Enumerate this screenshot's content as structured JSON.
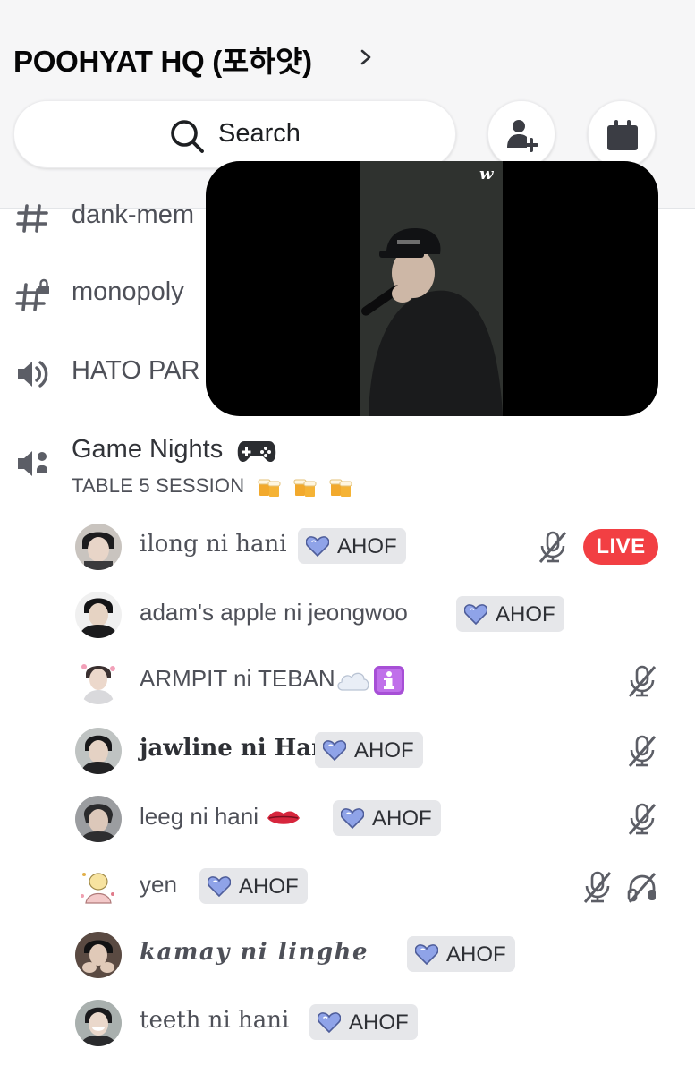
{
  "server": {
    "title": "POOHYAT HQ (포하얏)"
  },
  "search": {
    "label": "Search"
  },
  "channels": [
    {
      "name": "dank-mem"
    },
    {
      "name": "monopoly"
    },
    {
      "name": "HATO PAR"
    },
    {
      "name": "Game Nights",
      "subtitle": "TABLE 5 SESSION"
    }
  ],
  "pip": {
    "logo": "w"
  },
  "members": [
    {
      "name": "ilong ni hani",
      "tag": "AHOF",
      "live": "LIVE"
    },
    {
      "name": "adam's apple ni jeongwoo",
      "tag": "AHOF"
    },
    {
      "name": "ARMPIT ni TEBAN"
    },
    {
      "name": "jawline ni Hani",
      "tag": "AHOF"
    },
    {
      "name": "leeg ni hani",
      "tag": "AHOF"
    },
    {
      "name": "yen",
      "tag": "AHOF"
    },
    {
      "name": "kamay ni linghe",
      "tag": "AHOF"
    },
    {
      "name": "teeth ni hani",
      "tag": "AHOF"
    }
  ],
  "colors": {
    "live": "#f23f43",
    "tag_bg": "#e6e7ea",
    "heart": "#8fa3e8"
  },
  "icons": [
    "chevron-right-icon",
    "search-icon",
    "add-friend-icon",
    "calendar-icon",
    "hashtag-icon",
    "locked-hashtag-icon",
    "speaker-icon",
    "voice-speaker-icon",
    "muted-mic-icon",
    "deafened-headphones-icon",
    "heart-icon",
    "controller-emoji",
    "beer-emoji",
    "cloud-emoji",
    "info-emoji",
    "lips-emoji"
  ]
}
